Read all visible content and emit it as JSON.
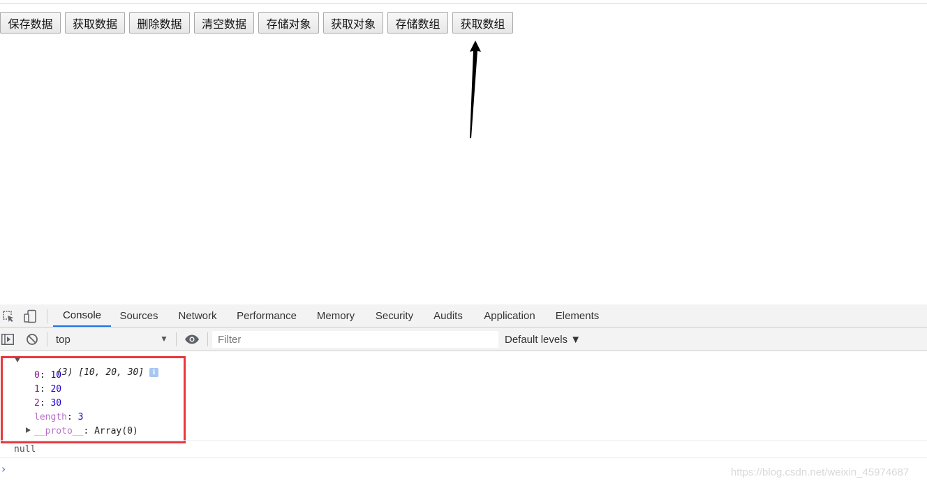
{
  "page": {
    "buttons": [
      "保存数据",
      "获取数据",
      "删除数据",
      "清空数据",
      "存储对象",
      "获取对象",
      "存储数组",
      "获取数组"
    ]
  },
  "devtools": {
    "tabs": [
      "Console",
      "Sources",
      "Network",
      "Performance",
      "Memory",
      "Security",
      "Audits",
      "Application",
      "Elements"
    ],
    "active_tab": "Console",
    "toolbar": {
      "context": "top",
      "context_caret": "▼",
      "filter_placeholder": "Filter",
      "levels": "Default levels ▼"
    },
    "console": {
      "array_summary": "(3) [10, 20, 30]",
      "info_badge": "i",
      "entries": [
        {
          "key": "0",
          "value": "10"
        },
        {
          "key": "1",
          "value": "20"
        },
        {
          "key": "2",
          "value": "30"
        }
      ],
      "length_key": "length",
      "length_value": "3",
      "proto_key": "__proto__",
      "proto_value": "Array(0)",
      "null_line": "null",
      "prompt_symbol": "›"
    },
    "accent_color": "#1a73e8",
    "highlight_color": "#e8383d"
  },
  "watermark": "https://blog.csdn.net/weixin_45974687"
}
